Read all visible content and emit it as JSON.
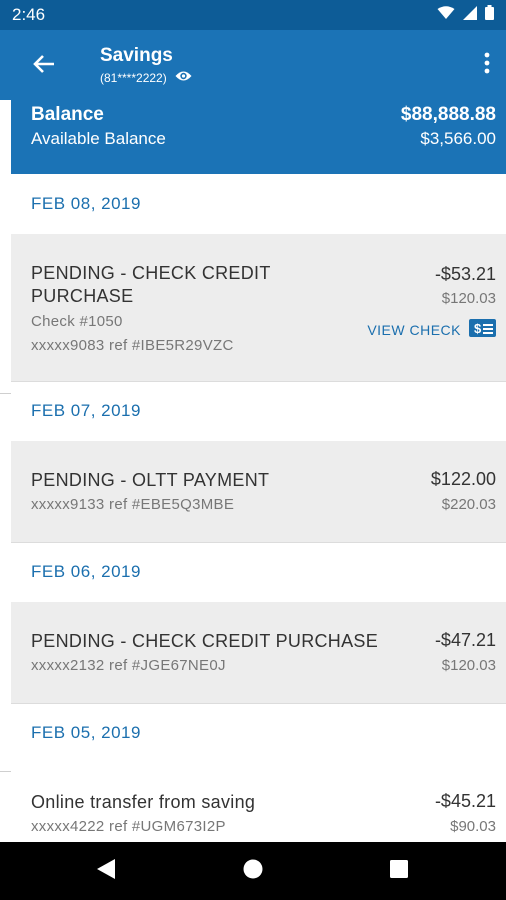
{
  "status_bar": {
    "time": "2:46",
    "icons": [
      "wifi-icon",
      "signal-icon",
      "battery-icon"
    ]
  },
  "app_bar": {
    "title": "Savings",
    "account_mask": "(81****2222)",
    "back_icon": "arrow-left-icon",
    "visibility_icon": "eye-icon",
    "menu_icon": "more-vertical-icon"
  },
  "balance": {
    "label": "Balance",
    "amount": "$88,888.88",
    "available_label": "Available Balance",
    "available_amount": "$3,566.00"
  },
  "groups": [
    {
      "date": "FEB 08, 2019",
      "transactions": [
        {
          "title_line1": "PENDING - CHECK CREDIT",
          "title_line2": "PURCHASE",
          "check_number": "Check #1050",
          "reference": "xxxxx9083 ref #IBE5R29VZC",
          "amount": "-$53.21",
          "balance": "$120.03",
          "action_label": "VIEW CHECK",
          "action_icon": "check-image-icon"
        }
      ]
    },
    {
      "date": "FEB 07, 2019",
      "transactions": [
        {
          "title": "PENDING - OLTT PAYMENT",
          "reference": "xxxxx9133 ref #EBE5Q3MBE",
          "amount": "$122.00",
          "balance": "$220.03"
        }
      ]
    },
    {
      "date": "FEB 06, 2019",
      "transactions": [
        {
          "title": "PENDING - CHECK CREDIT PURCHASE",
          "reference": "xxxxx2132 ref #JGE67NE0J",
          "amount": "-$47.21",
          "balance": "$120.03"
        }
      ]
    },
    {
      "date": "FEB 05, 2019",
      "transactions": [
        {
          "title": "Online transfer from saving",
          "reference": "xxxxx4222 ref #UGM673I2P",
          "amount": "-$45.21",
          "balance": "$90.03"
        }
      ]
    }
  ],
  "nav_bar": {
    "back": "triangle-back-icon",
    "home": "circle-home-icon",
    "recents": "square-recents-icon"
  },
  "colors": {
    "primary": "#1b73b6",
    "status_bar": "#0d5c97",
    "date_text": "#1b6fae",
    "card_bg": "#ededed"
  }
}
